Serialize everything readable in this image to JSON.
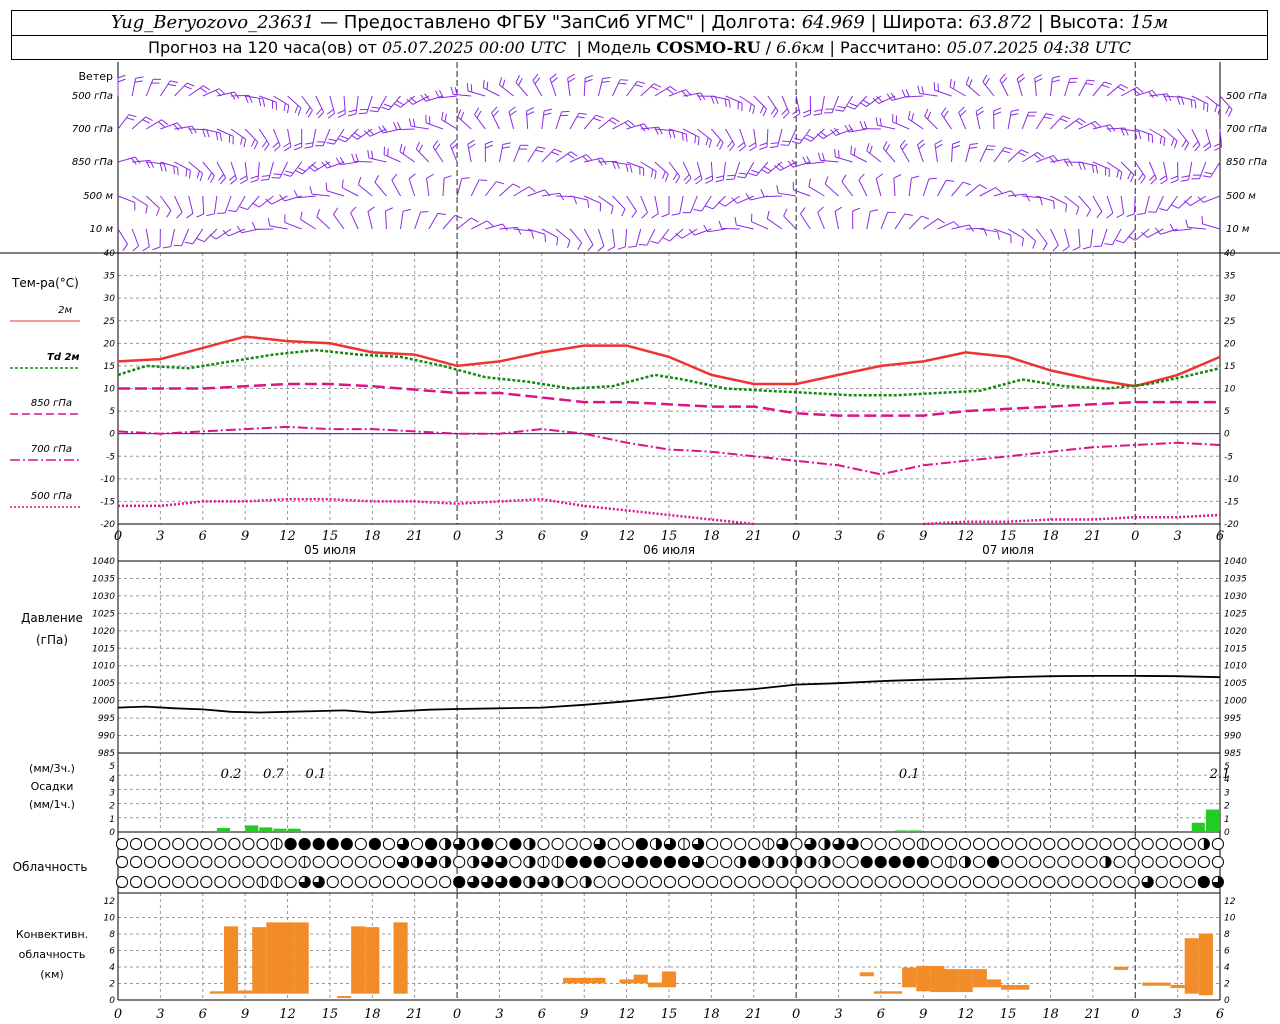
{
  "header": {
    "station": "Yug_Beryozovo_23631",
    "provider": "— Предоставлено ФГБУ \"ЗапСиб УГМС\"",
    "lon_label": "Долгота:",
    "lon": "64.969",
    "lat_label": "Широта:",
    "lat": "63.872",
    "alt_label": "Высота:",
    "alt": "15м",
    "forecast_label": "Прогноз на 120 часа(ов) от",
    "forecast_from": "05.07.2025 00:00 UTC",
    "model_label": "Модель",
    "model": "COSMO-RU",
    "resolution": "6.6км",
    "calc_label": "Рассчитано:",
    "calc_time": "05.07.2025 04:38 UTC"
  },
  "colors": {
    "t2m": "#ee3333",
    "td": "#118811",
    "levels": "#dd1188",
    "wind": "#8a2be2",
    "pressure": "#000000",
    "precip": "#22cc22",
    "conv": "#f28c28",
    "zero_line": "#2222cc"
  },
  "x_ticks": [
    "0",
    "3",
    "6",
    "9",
    "12",
    "15",
    "18",
    "21",
    "0",
    "3",
    "6",
    "9",
    "12",
    "15",
    "18",
    "21",
    "0",
    "3",
    "6",
    "9",
    "12",
    "15",
    "18",
    "21",
    "0",
    "3",
    "6"
  ],
  "dates": [
    "05 июля",
    "06 июля",
    "07 июля"
  ],
  "wind_panel": {
    "title": "Ветер",
    "levels": [
      "500 гПа",
      "700 гПа",
      "850 гПа",
      "500 м",
      "10 м"
    ]
  },
  "temp_panel": {
    "title": "Тем-ра(°C)",
    "legend": [
      "2м",
      "Td 2м",
      "850 гПа",
      "700 гПа",
      "500 гПа"
    ],
    "y_ticks": [
      "40",
      "35",
      "30",
      "25",
      "20",
      "15",
      "10",
      "5",
      "0",
      "-5",
      "-10",
      "-15",
      "-20"
    ]
  },
  "pressure_panel": {
    "title1": "Давление",
    "title2": "(гПа)",
    "y_ticks": [
      "1040",
      "1035",
      "1030",
      "1025",
      "1020",
      "1015",
      "1010",
      "1005",
      "1000",
      "995",
      "990",
      "985"
    ]
  },
  "precip_panel": {
    "title1": "(мм/3ч.)",
    "title2": "Осадки",
    "title3": "(мм/1ч.)",
    "y_ticks": [
      "5",
      "4",
      "3",
      "2",
      "1",
      "0"
    ],
    "annotations": [
      {
        "h": 8,
        "text": "0.2"
      },
      {
        "h": 11,
        "text": "0.7"
      },
      {
        "h": 14,
        "text": "0.1"
      },
      {
        "h": 56,
        "text": "0.1"
      },
      {
        "h": 78,
        "text": "2.1"
      }
    ]
  },
  "cloud_panel": {
    "title": "Облачность"
  },
  "conv_panel": {
    "title1": "Конвективн.",
    "title2": "облачность",
    "title3": "(км)",
    "y_ticks": [
      "12",
      "10",
      "8",
      "6",
      "4",
      "2",
      "0"
    ]
  },
  "chart_data": {
    "type": "meteogram",
    "x_unit": "hours since 05.07.2025 00:00 UTC",
    "x_range": [
      0,
      78
    ],
    "temperature": {
      "ylim": [
        -20,
        40
      ],
      "t2m": [
        [
          0,
          16
        ],
        [
          3,
          16.5
        ],
        [
          6,
          19
        ],
        [
          9,
          21.5
        ],
        [
          12,
          20.5
        ],
        [
          15,
          20
        ],
        [
          18,
          18
        ],
        [
          21,
          17.5
        ],
        [
          24,
          15
        ],
        [
          27,
          16
        ],
        [
          30,
          18
        ],
        [
          33,
          19.5
        ],
        [
          36,
          19.5
        ],
        [
          39,
          17
        ],
        [
          42,
          13
        ],
        [
          45,
          11
        ],
        [
          48,
          11
        ],
        [
          51,
          13
        ],
        [
          54,
          15
        ],
        [
          57,
          16
        ],
        [
          60,
          18
        ],
        [
          63,
          17
        ],
        [
          66,
          14
        ],
        [
          69,
          12
        ],
        [
          72,
          10.5
        ],
        [
          75,
          13
        ],
        [
          78,
          17
        ]
      ],
      "td2m": [
        [
          0,
          13
        ],
        [
          2,
          15
        ],
        [
          5,
          14.5
        ],
        [
          8,
          16
        ],
        [
          11,
          17.5
        ],
        [
          14,
          18.5
        ],
        [
          17,
          17.5
        ],
        [
          20,
          17
        ],
        [
          23,
          15
        ],
        [
          26,
          12.5
        ],
        [
          29,
          11.5
        ],
        [
          32,
          10
        ],
        [
          35,
          10.5
        ],
        [
          38,
          13
        ],
        [
          40,
          12
        ],
        [
          43,
          10
        ],
        [
          46,
          9.5
        ],
        [
          49,
          9
        ],
        [
          52,
          8.5
        ],
        [
          55,
          8.5
        ],
        [
          58,
          9
        ],
        [
          61,
          9.5
        ],
        [
          64,
          12
        ],
        [
          67,
          10.5
        ],
        [
          70,
          10
        ],
        [
          73,
          11
        ],
        [
          76,
          13
        ],
        [
          78,
          14.5
        ]
      ],
      "t850": [
        [
          0,
          10
        ],
        [
          6,
          10
        ],
        [
          12,
          11
        ],
        [
          15,
          11
        ],
        [
          18,
          10.5
        ],
        [
          24,
          9
        ],
        [
          27,
          9
        ],
        [
          30,
          8
        ],
        [
          33,
          7
        ],
        [
          36,
          7
        ],
        [
          42,
          6
        ],
        [
          45,
          6
        ],
        [
          48,
          4.5
        ],
        [
          51,
          4
        ],
        [
          54,
          4
        ],
        [
          57,
          4
        ],
        [
          60,
          5
        ],
        [
          63,
          5.5
        ],
        [
          66,
          6
        ],
        [
          69,
          6.5
        ],
        [
          72,
          7
        ],
        [
          75,
          7
        ],
        [
          78,
          7
        ]
      ],
      "t700": [
        [
          0,
          0.5
        ],
        [
          3,
          0
        ],
        [
          6,
          0.5
        ],
        [
          9,
          1
        ],
        [
          12,
          1.5
        ],
        [
          15,
          1
        ],
        [
          18,
          1
        ],
        [
          21,
          0.5
        ],
        [
          24,
          0
        ],
        [
          27,
          0
        ],
        [
          30,
          1
        ],
        [
          33,
          0
        ],
        [
          36,
          -2
        ],
        [
          39,
          -3.5
        ],
        [
          42,
          -4
        ],
        [
          45,
          -5
        ],
        [
          48,
          -6
        ],
        [
          51,
          -7
        ],
        [
          54,
          -9
        ],
        [
          57,
          -7
        ],
        [
          60,
          -6
        ],
        [
          63,
          -5
        ],
        [
          66,
          -4
        ],
        [
          69,
          -3
        ],
        [
          72,
          -2.5
        ],
        [
          75,
          -2
        ],
        [
          78,
          -2.5
        ]
      ],
      "t500": [
        [
          0,
          -16
        ],
        [
          3,
          -16
        ],
        [
          6,
          -15
        ],
        [
          9,
          -15
        ],
        [
          12,
          -14.5
        ],
        [
          15,
          -14.5
        ],
        [
          18,
          -15
        ],
        [
          21,
          -15
        ],
        [
          24,
          -15.5
        ],
        [
          27,
          -15
        ],
        [
          30,
          -14.5
        ],
        [
          33,
          -16
        ],
        [
          36,
          -17
        ],
        [
          39,
          -18
        ],
        [
          42,
          -19
        ],
        [
          45,
          -20
        ],
        [
          57,
          -20
        ],
        [
          60,
          -19.5
        ],
        [
          63,
          -19.5
        ],
        [
          66,
          -19
        ],
        [
          69,
          -19
        ],
        [
          72,
          -18.5
        ],
        [
          75,
          -18.5
        ],
        [
          78,
          -18
        ]
      ]
    },
    "pressure": {
      "ylim": [
        985,
        1040
      ],
      "values": [
        [
          0,
          998
        ],
        [
          2,
          998.3
        ],
        [
          4,
          997.8
        ],
        [
          6,
          997.5
        ],
        [
          8,
          996.8
        ],
        [
          10,
          996.6
        ],
        [
          12,
          996.8
        ],
        [
          14,
          997
        ],
        [
          16,
          997.2
        ],
        [
          18,
          996.6
        ],
        [
          20,
          997
        ],
        [
          22,
          997.4
        ],
        [
          24,
          997.6
        ],
        [
          27,
          997.8
        ],
        [
          30,
          998
        ],
        [
          33,
          998.8
        ],
        [
          36,
          999.8
        ],
        [
          39,
          1001
        ],
        [
          42,
          1002.5
        ],
        [
          45,
          1003.3
        ],
        [
          48,
          1004.6
        ],
        [
          51,
          1005
        ],
        [
          54,
          1005.6
        ],
        [
          57,
          1006
        ],
        [
          60,
          1006.3
        ],
        [
          63,
          1006.7
        ],
        [
          66,
          1007
        ],
        [
          69,
          1007.1
        ],
        [
          72,
          1007.1
        ],
        [
          75,
          1007
        ],
        [
          78,
          1006.7
        ]
      ]
    },
    "precipitation": {
      "ylim": [
        0,
        5
      ],
      "bars_mm_per_1h": [
        [
          7.5,
          0.3
        ],
        [
          9.5,
          0.5
        ],
        [
          10.5,
          0.35
        ],
        [
          11.5,
          0.25
        ],
        [
          12.5,
          0.25
        ],
        [
          55.5,
          0.12
        ],
        [
          56.5,
          0.12
        ],
        [
          76.5,
          0.7
        ],
        [
          77.5,
          1.7
        ]
      ]
    },
    "cloudiness": {
      "rows": [
        "high",
        "middle",
        "low"
      ],
      "hours_per_symbol": 1,
      "high": [
        0,
        0,
        0,
        0,
        0,
        0,
        0,
        0,
        0,
        0,
        0,
        1,
        4,
        4,
        4,
        4,
        4,
        0,
        4,
        0,
        3,
        0,
        4,
        2,
        3,
        2,
        4,
        0,
        4,
        2,
        0,
        0,
        0,
        0,
        3,
        0,
        0,
        4,
        2,
        3,
        1,
        3,
        0,
        0,
        0,
        0,
        1,
        3,
        0,
        3,
        2,
        3,
        3,
        0,
        0,
        0,
        0,
        1,
        0,
        0,
        0,
        0,
        0,
        0,
        0,
        0,
        0,
        0,
        0,
        0,
        0,
        0,
        0,
        0,
        0,
        0,
        0,
        2,
        0
      ],
      "middle": [
        0,
        0,
        0,
        0,
        0,
        0,
        0,
        0,
        0,
        0,
        0,
        0,
        0,
        1,
        0,
        0,
        0,
        0,
        0,
        0,
        3,
        2,
        3,
        2,
        0,
        2,
        3,
        3,
        0,
        2,
        1,
        1,
        4,
        4,
        4,
        0,
        3,
        4,
        4,
        4,
        4,
        3,
        0,
        0,
        2,
        4,
        2,
        2,
        2,
        2,
        2,
        0,
        0,
        4,
        4,
        4,
        4,
        4,
        0,
        1,
        2,
        0,
        4,
        0,
        0,
        0,
        0,
        0,
        0,
        0,
        2,
        0,
        0,
        0,
        0,
        0,
        0,
        0,
        0
      ],
      "low": [
        0,
        0,
        0,
        0,
        0,
        0,
        0,
        0,
        0,
        0,
        1,
        1,
        0,
        3,
        3,
        0,
        0,
        0,
        0,
        0,
        0,
        0,
        0,
        0,
        4,
        3,
        3,
        3,
        4,
        2,
        3,
        2,
        0,
        2,
        0,
        0,
        0,
        0,
        0,
        0,
        0,
        0,
        0,
        0,
        0,
        0,
        0,
        0,
        0,
        0,
        0,
        0,
        0,
        0,
        0,
        0,
        0,
        0,
        0,
        0,
        0,
        0,
        0,
        0,
        0,
        0,
        0,
        0,
        0,
        0,
        0,
        0,
        0,
        3,
        0,
        0,
        0,
        4,
        3
      ]
    },
    "convective_cloud_km": {
      "ylim": [
        0,
        13
      ],
      "bars": [
        [
          7,
          0.8,
          1.1
        ],
        [
          8,
          0.8,
          9.3
        ],
        [
          9,
          0.8,
          1.2
        ],
        [
          10,
          0.8,
          9.2
        ],
        [
          11,
          0.8,
          9.8
        ],
        [
          12,
          0.8,
          9.8
        ],
        [
          13,
          0.8,
          9.8
        ],
        [
          16,
          0.4,
          0.5
        ],
        [
          17,
          0.8,
          9.3
        ],
        [
          18,
          0.8,
          9.2
        ],
        [
          20,
          0.8,
          9.8
        ],
        [
          32,
          2.1,
          2.8
        ],
        [
          33,
          2.1,
          2.8
        ],
        [
          34,
          2.1,
          2.8
        ],
        [
          36,
          2.1,
          2.6
        ],
        [
          37,
          2.1,
          3.2
        ],
        [
          38,
          1.6,
          2.2
        ],
        [
          39,
          1.6,
          3.6
        ],
        [
          53,
          3.0,
          3.5
        ],
        [
          54,
          0.8,
          1.1
        ],
        [
          55,
          0.8,
          1.1
        ],
        [
          56,
          1.6,
          4.1
        ],
        [
          57,
          1.1,
          4.3
        ],
        [
          58,
          1.0,
          4.3
        ],
        [
          59,
          1.0,
          3.9
        ],
        [
          60,
          1.0,
          3.9
        ],
        [
          61,
          1.6,
          3.9
        ],
        [
          62,
          1.6,
          2.6
        ],
        [
          63,
          1.3,
          1.9
        ],
        [
          64,
          1.3,
          1.9
        ],
        [
          71,
          3.8,
          4.2
        ],
        [
          73,
          1.8,
          2.2
        ],
        [
          74,
          1.8,
          2.2
        ],
        [
          75,
          1.5,
          1.9
        ],
        [
          76,
          0.8,
          7.8
        ],
        [
          77,
          0.6,
          8.4
        ]
      ]
    }
  }
}
